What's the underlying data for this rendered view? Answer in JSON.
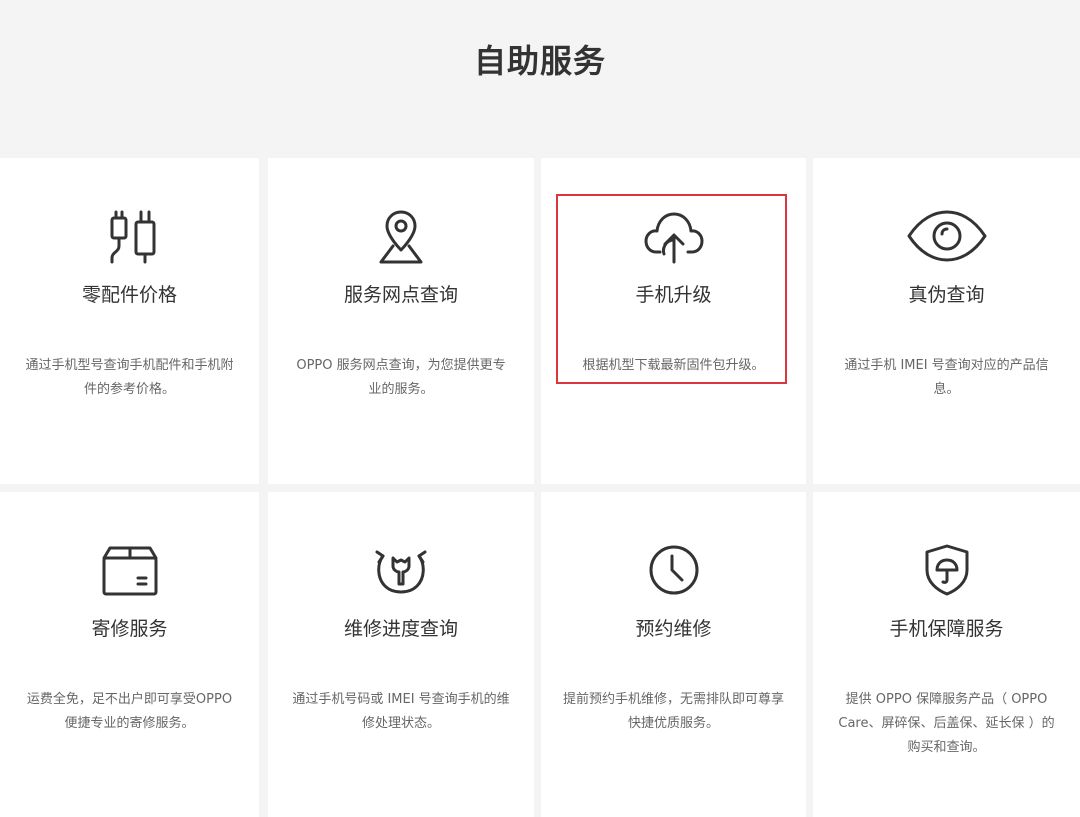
{
  "page": {
    "title": "自助服务"
  },
  "cards": [
    {
      "icon": "charger-cable-icon",
      "title": "零配件价格",
      "desc": "通过手机型号查询手机配件和手机附件的参考价格。"
    },
    {
      "icon": "location-pin-icon",
      "title": "服务网点查询",
      "desc": "OPPO 服务网点查询，为您提供更专业的服务。"
    },
    {
      "icon": "cloud-upload-icon",
      "title": "手机升级",
      "desc": "根据机型下载最新固件包升级。",
      "highlighted": true
    },
    {
      "icon": "eye-icon",
      "title": "真伪查询",
      "desc": "通过手机 IMEI 号查询对应的产品信息。"
    },
    {
      "icon": "box-icon",
      "title": "寄修服务",
      "desc": "运费全免，足不出户即可享受OPPO 便捷专业的寄修服务。"
    },
    {
      "icon": "wrench-refresh-icon",
      "title": "维修进度查询",
      "desc": "通过手机号码或 IMEI 号查询手机的维修处理状态。"
    },
    {
      "icon": "clock-icon",
      "title": "预约维修",
      "desc": "提前预约手机维修，无需排队即可尊享快捷优质服务。"
    },
    {
      "icon": "shield-umbrella-icon",
      "title": "手机保障服务",
      "desc": "提供 OPPO 保障服务产品（ OPPO Care、屏碎保、后盖保、延长保 ）的购买和查询。"
    }
  ],
  "colors": {
    "background": "#f4f4f4",
    "card": "#ffffff",
    "text": "#333333",
    "muted": "#666666",
    "highlight": "#d9363e"
  }
}
